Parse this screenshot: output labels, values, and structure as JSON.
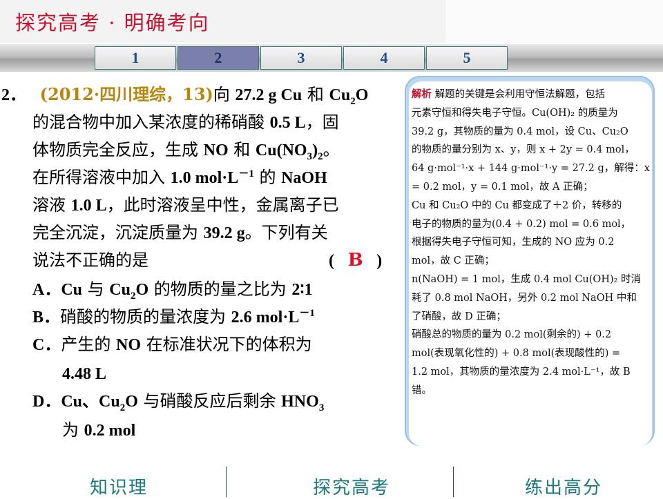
{
  "header": {
    "title": "探究高考 · 明确考向"
  },
  "tabs": [
    "1",
    "2",
    "3",
    "4",
    "5"
  ],
  "active_tab": "2",
  "question": {
    "number": "2．",
    "source": "(2012·四川理综，13)",
    "l1_a": "向 ",
    "l1_b": "27.2 g Cu",
    "l1_c": " 和 ",
    "l1_d": "Cu",
    "l1_sub": "2",
    "l1_e": "O",
    "l2_a": "的混合物中加入某浓度的稀硝酸 ",
    "l2_b": "0.5 L",
    "l2_c": "，固",
    "l3_a": "体物质完全反应，生成 ",
    "l3_b": "NO",
    "l3_c": "  和 ",
    "l3_d": "Cu(NO",
    "l3_sub1": "3",
    "l3_e": ")",
    "l3_sub2": "2",
    "l3_f": "。",
    "l4_a": "在所得溶液中加入  ",
    "l4_b": "1.0  mol·L",
    "l4_sup": "－1",
    "l4_c": " 的  ",
    "l4_d": "NaOH",
    "l5_a": "溶液 ",
    "l5_b": "1.0 L",
    "l5_c": "，此时溶液呈中性，金属离子已",
    "l6_a": "完全沉淀，沉淀质量为 ",
    "l6_b": "39.2  g",
    "l6_c": "。下列有关",
    "l7_a": "说法不正确的是",
    "paren_open": "(",
    "answer": "B",
    "paren_close": ")",
    "optA_a": "A．",
    "optA_b": "Cu",
    "optA_c": " 与 ",
    "optA_d": "Cu",
    "optA_sub": "2",
    "optA_e": "O",
    "optA_f": "  的物质的量之比为 ",
    "optA_g": "2∶1",
    "optB_a": "B．",
    "optB_b": "硝酸的物质的量浓度为 ",
    "optB_c": "2.6 mol·L",
    "optB_sup": "－1",
    "optC_a": "C．",
    "optC_b": "产生的 ",
    "optC_c": "NO",
    "optC_d": " 在标准状况下的体积为",
    "optC_e": "4.48 L",
    "optD_a": "D．",
    "optD_b": "Cu、Cu",
    "optD_sub": "2",
    "optD_c": "O",
    "optD_d": " 与硝酸反应后剩余 ",
    "optD_e": "HNO",
    "optD_sub2": "3",
    "optD_f": "为 ",
    "optD_g": "0.2 mol"
  },
  "explanation": {
    "label": "解析",
    "lines": [
      "   解题的关键是会利用守恒法解题，包括",
      "元素守恒和得失电子守恒。Cu(OH)₂ 的质量为",
      "39.2 g，其物质的量为 0.4 mol，设 Cu、Cu₂O",
      "的物质的量分别为 x、y，则 x + 2y = 0.4 mol，",
      "64 g·mol⁻¹·x + 144 g·mol⁻¹·y = 27.2 g，解得：x",
      " = 0.2 mol，y = 0.1 mol，故 A 正确；",
      "Cu 和 Cu₂O 中的 Cu 都变成了＋2 价，转移的",
      "电子的物质的量为(0.4 + 0.2)  mol = 0.6  mol，",
      "根据得失电子守恒可知，生成的 NO 应为 0.2",
      "mol，故 C 正确；",
      "n(NaOH) = 1 mol，生成 0.4 mol Cu(OH)₂ 时消",
      "耗了 0.8 mol NaOH，另外 0.2 mol NaOH 中和",
      "了硝酸，故 D 正确；",
      "硝酸总的物质的量为  0.2  mol(剩余的) + 0.2",
      "mol(表现氧化性的) + 0.8  mol(表现酸性的) =",
      "1.2 mol，其物质的量浓度为 2.4 mol·L⁻¹，故 B",
      "错。"
    ]
  },
  "footer": {
    "items": [
      "知识理",
      "探究高考",
      "练出高分"
    ]
  }
}
